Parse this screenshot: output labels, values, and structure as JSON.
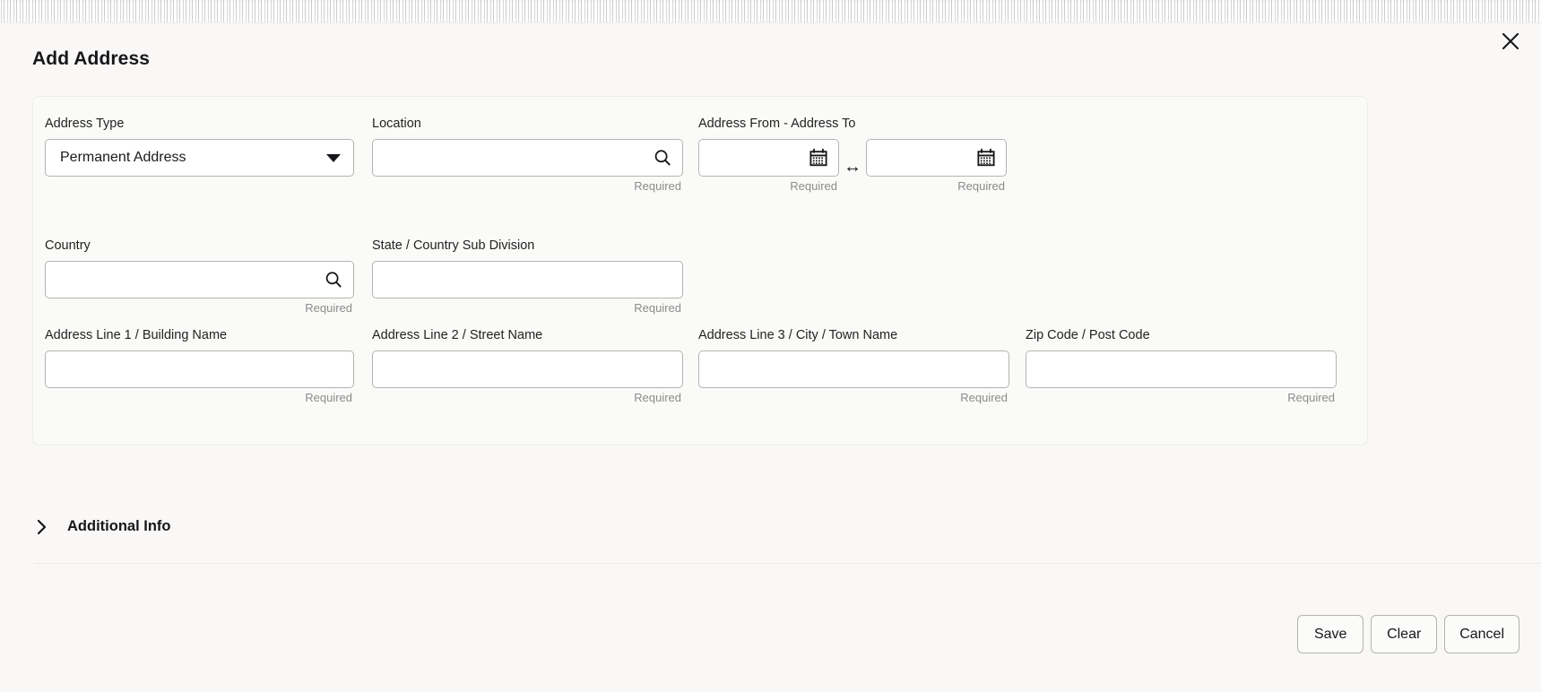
{
  "modal": {
    "title": "Add Address",
    "close_icon": "close-icon"
  },
  "form": {
    "address_type": {
      "label": "Address Type",
      "value": "Permanent Address",
      "icon": "chevron-down-icon"
    },
    "location": {
      "label": "Location",
      "value": "",
      "placeholder": "",
      "helper": "Required",
      "icon": "search-icon"
    },
    "address_period": {
      "label": "Address From - Address To",
      "from": {
        "value": "",
        "placeholder": "",
        "helper": "Required",
        "icon": "calendar-icon"
      },
      "separator": "↔",
      "to": {
        "value": "",
        "placeholder": "",
        "helper": "Required",
        "icon": "calendar-icon"
      }
    },
    "country": {
      "label": "Country",
      "value": "",
      "placeholder": "",
      "helper": "Required",
      "icon": "search-icon"
    },
    "state": {
      "label": "State / Country Sub Division",
      "value": "",
      "placeholder": "",
      "helper": "Required"
    },
    "address_line_1": {
      "label": "Address Line 1 / Building Name",
      "value": "",
      "placeholder": "",
      "helper": "Required"
    },
    "address_line_2": {
      "label": "Address Line 2 / Street Name",
      "value": "",
      "placeholder": "",
      "helper": "Required"
    },
    "address_line_3": {
      "label": "Address Line 3 / City / Town Name",
      "value": "",
      "placeholder": "",
      "helper": "Required"
    },
    "zip_code": {
      "label": "Zip Code / Post Code",
      "value": "",
      "placeholder": "",
      "helper": "Required"
    }
  },
  "additional_info": {
    "label": "Additional Info",
    "expanded": false,
    "icon": "chevron-right-icon"
  },
  "footer": {
    "save_label": "Save",
    "clear_label": "Clear",
    "cancel_label": "Cancel"
  },
  "colors": {
    "page_background": "#f9f8f7",
    "card_background": "#fafaf9",
    "input_border": "#b5b3b1",
    "text": "#1c1b1a",
    "helper_text": "#8c8b8a"
  }
}
